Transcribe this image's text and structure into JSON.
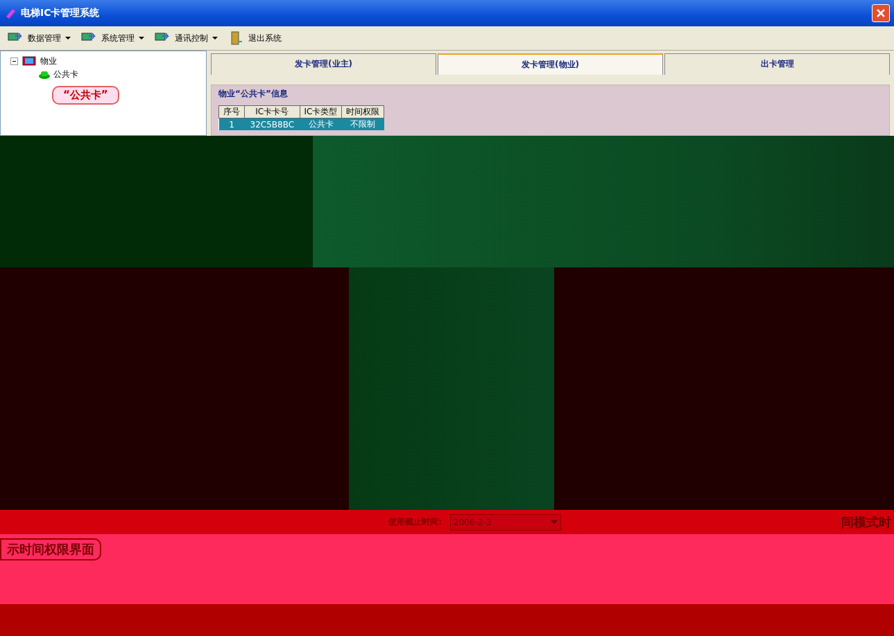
{
  "window": {
    "title": "电梯IC卡管理系统"
  },
  "toolbar": [
    {
      "label": "数据管理",
      "dropdown": true
    },
    {
      "label": "系统管理",
      "dropdown": true
    },
    {
      "label": "通讯控制",
      "dropdown": true
    },
    {
      "label": "退出系统",
      "dropdown": false
    }
  ],
  "tree": {
    "label": "物业",
    "expanded": true,
    "children": [
      {
        "label": "公共卡"
      }
    ]
  },
  "callouts": {
    "tree": "“公共卡”",
    "time_permission": "示时间权限界面",
    "time_mode": "间模式时"
  },
  "tabs": [
    {
      "label": "发卡管理(业主)",
      "selected": false
    },
    {
      "label": "发卡管理(物业)",
      "selected": true
    },
    {
      "label": "出卡管理",
      "selected": false
    }
  ],
  "group": {
    "title": "物业“公共卡”信息"
  },
  "table": {
    "columns": [
      "序号",
      "IC卡卡号",
      "IC卡类型",
      "时间权限"
    ],
    "rows": [
      {
        "cells": [
          "1",
          "32C5B8BC",
          "公共卡",
          "不限制"
        ],
        "selected": true
      }
    ]
  },
  "expiry": {
    "label": "使用截止时间:",
    "value": "2006-2-3"
  }
}
